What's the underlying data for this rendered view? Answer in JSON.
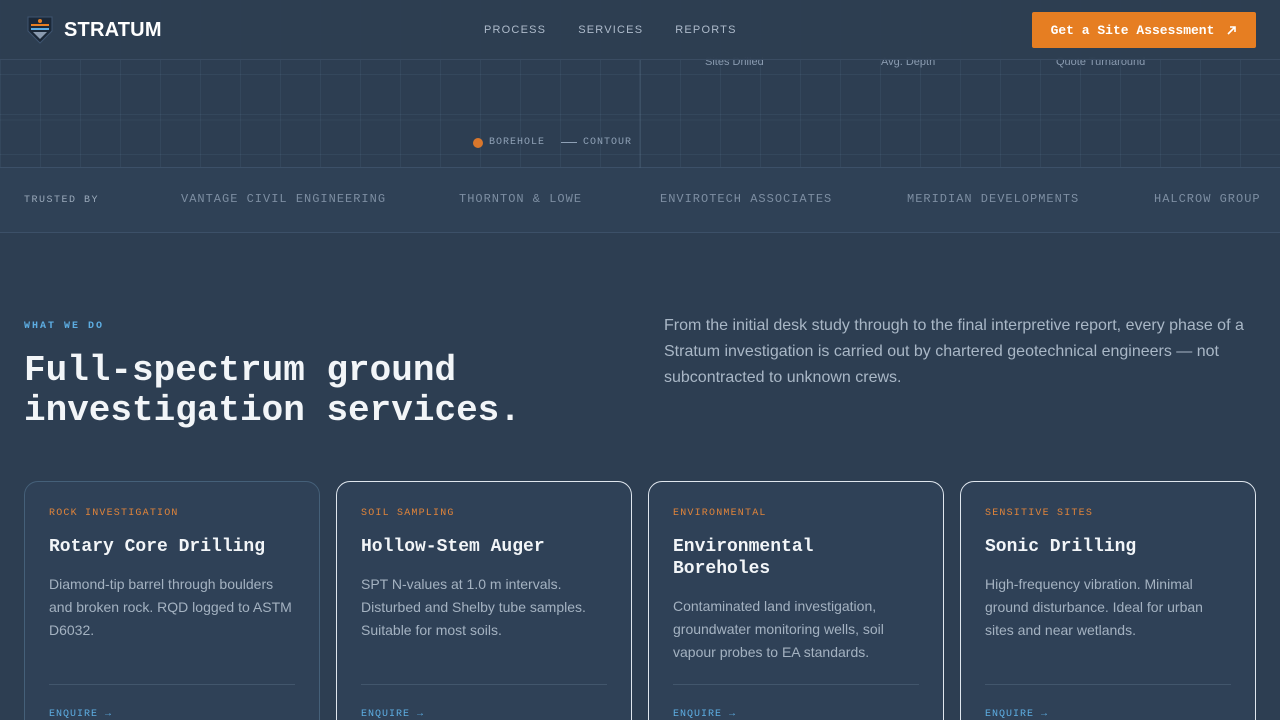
{
  "header": {
    "brand": "STRATUM",
    "nav": [
      "PROCESS",
      "SERVICES",
      "REPORTS"
    ],
    "cta_label": "Get a Site Assessment",
    "cta_icon": "arrow-up-right-icon",
    "accent_color": "#e67e22"
  },
  "hero": {
    "stats": [
      "Sites Drilled",
      "Avg. Depth",
      "Quote Turnaround"
    ],
    "legend": {
      "borehole": "BOREHOLE",
      "contour": "CONTOUR"
    }
  },
  "trusted": {
    "label": "TRUSTED BY",
    "clients": [
      "VANTAGE CIVIL ENGINEERING",
      "THORNTON & LOWE",
      "ENVIROTECH ASSOCIATES",
      "MERIDIAN DEVELOPMENTS",
      "HALCROW GROUP"
    ]
  },
  "services": {
    "eyebrow": "WHAT WE DO",
    "title": "Full-spectrum ground investigation services.",
    "description": "From the initial desk study through to the final interpretive report, every phase of a Stratum investigation is carried out by chartered geotechnical engineers — not subcontracted to unknown crews.",
    "cards": [
      {
        "tag": "ROCK INVESTIGATION",
        "title": "Rotary Core Drilling",
        "description": "Diamond-tip barrel through boulders and broken rock. RQD logged to ASTM D6032.",
        "link": "ENQUIRE →"
      },
      {
        "tag": "SOIL SAMPLING",
        "title": "Hollow-Stem Auger",
        "description": "SPT N-values at 1.0 m intervals. Disturbed and Shelby tube samples. Suitable for most soils.",
        "link": "ENQUIRE →"
      },
      {
        "tag": "ENVIRONMENTAL",
        "title": "Environmental Boreholes",
        "description": "Contaminated land investigation, groundwater monitoring wells, soil vapour probes to EA standards.",
        "link": "ENQUIRE →"
      },
      {
        "tag": "SENSITIVE SITES",
        "title": "Sonic Drilling",
        "description": "High-frequency vibration. Minimal ground disturbance. Ideal for urban sites and near wetlands.",
        "link": "ENQUIRE →"
      }
    ]
  }
}
